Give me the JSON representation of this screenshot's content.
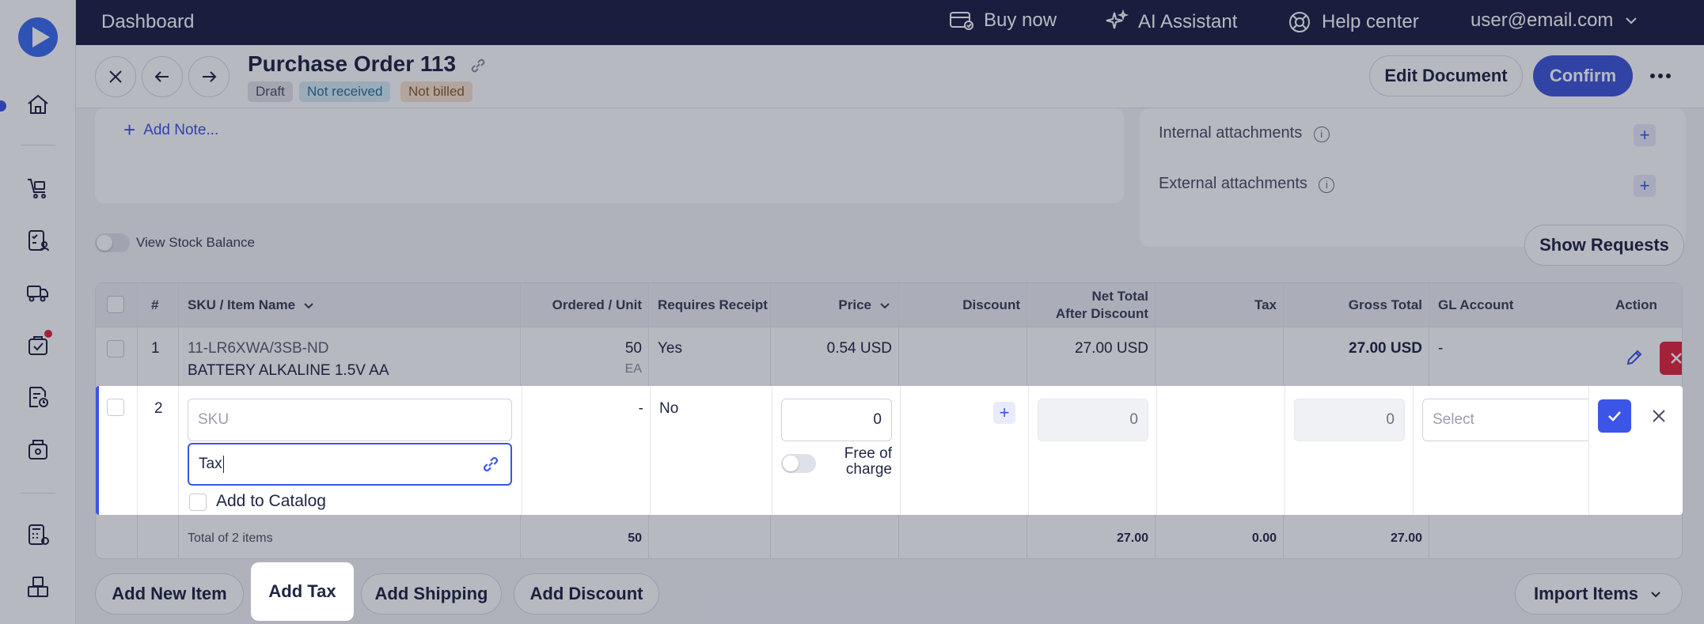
{
  "topbar": {
    "title": "Dashboard",
    "buy_now": "Buy now",
    "ai_assistant": "AI Assistant",
    "help_center": "Help center",
    "user_email": "user@email.com"
  },
  "header": {
    "doc_title": "Purchase Order 113",
    "badges": [
      {
        "label": "Draft",
        "bg": "#e3e4ea",
        "fg": "#4a4f63"
      },
      {
        "label": "Not received",
        "bg": "#d6ecf7",
        "fg": "#2f6f93"
      },
      {
        "label": "Not billed",
        "bg": "#f8e2cf",
        "fg": "#8a5a2b"
      }
    ],
    "edit_document": "Edit Document",
    "confirm": "Confirm"
  },
  "notes": {
    "add_note": "Add Note..."
  },
  "attachments": {
    "internal": "Internal attachments",
    "external": "External attachments"
  },
  "stock": {
    "view_stock_balance": "View Stock Balance",
    "show_requests": "Show Requests"
  },
  "table": {
    "headers": {
      "num": "#",
      "sku": "SKU / Item Name",
      "ordered": "Ordered / Unit",
      "requires": "Requires Receipt",
      "price": "Price",
      "discount": "Discount",
      "net_total_1": "Net Total",
      "net_total_2": "After Discount",
      "tax": "Tax",
      "gross": "Gross Total",
      "gl": "GL Account",
      "action": "Action"
    },
    "row1": {
      "num": "1",
      "sku": "11-LR6XWA/3SB-ND",
      "name": "BATTERY ALKALINE 1.5V AA",
      "ordered": "50",
      "unit": "EA",
      "requires": "Yes",
      "price": "0.54 USD",
      "net_total": "27.00 USD",
      "gross": "27.00 USD",
      "gl": "-"
    },
    "row2": {
      "num": "2",
      "sku_placeholder": "SKU",
      "name_value": "Tax",
      "add_to_catalog": "Add to Catalog",
      "ordered": "-",
      "requires": "No",
      "price_value": "0",
      "free_of_charge_1": "Free of",
      "free_of_charge_2": "charge",
      "net_total": "0",
      "gross": "0",
      "gl_placeholder": "Select"
    },
    "footer": {
      "total_label": "Total of 2 items",
      "ordered": "50",
      "net_total": "27.00",
      "tax": "0.00",
      "gross": "27.00"
    }
  },
  "actions": {
    "add_new_item": "Add New Item",
    "add_tax": "Add Tax",
    "add_shipping": "Add Shipping",
    "add_discount": "Add Discount",
    "import_items": "Import Items"
  },
  "colors": {
    "accent": "#3b55e6",
    "topbar": "#1d2147",
    "danger": "#e2263e"
  }
}
